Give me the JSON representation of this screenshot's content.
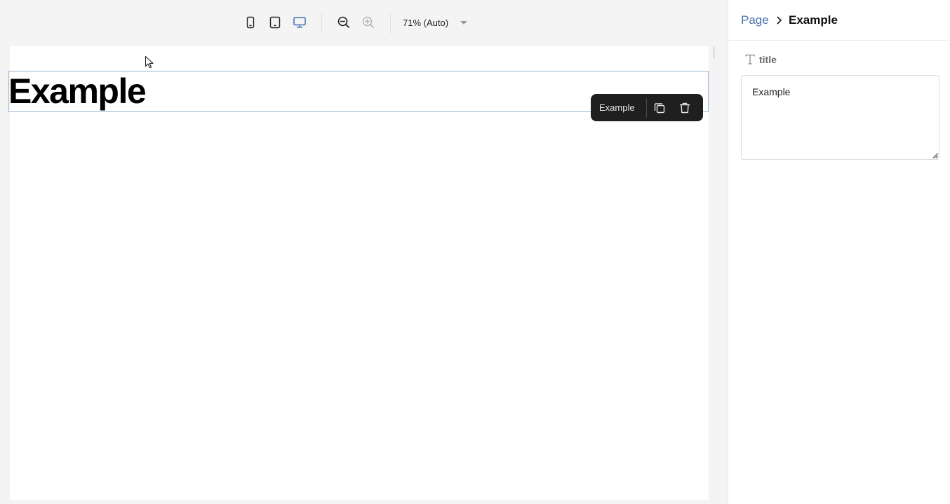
{
  "toolbar": {
    "devices": [
      {
        "name": "mobile-view",
        "icon": "mobile-icon",
        "active": false
      },
      {
        "name": "tablet-view",
        "icon": "tablet-icon",
        "active": false
      },
      {
        "name": "desktop-view",
        "icon": "desktop-icon",
        "active": true
      }
    ],
    "zoom_out_icon": "zoom-out-icon",
    "zoom_in_icon": "zoom-in-icon",
    "zoom_label": "71% (Auto)"
  },
  "canvas": {
    "heading_text": "Example",
    "block_menu": {
      "label": "Example",
      "duplicate_icon": "duplicate-icon",
      "delete_icon": "trash-icon"
    }
  },
  "panel": {
    "breadcrumb": {
      "parent": "Page",
      "current": "Example"
    },
    "field": {
      "label": "title",
      "value": "Example"
    }
  },
  "colors": {
    "accent": "#4a72a8",
    "active_device": "#3d6fb4",
    "selection_outline": "#9bb7d6",
    "block_menu_bg": "#1f1f1f"
  }
}
